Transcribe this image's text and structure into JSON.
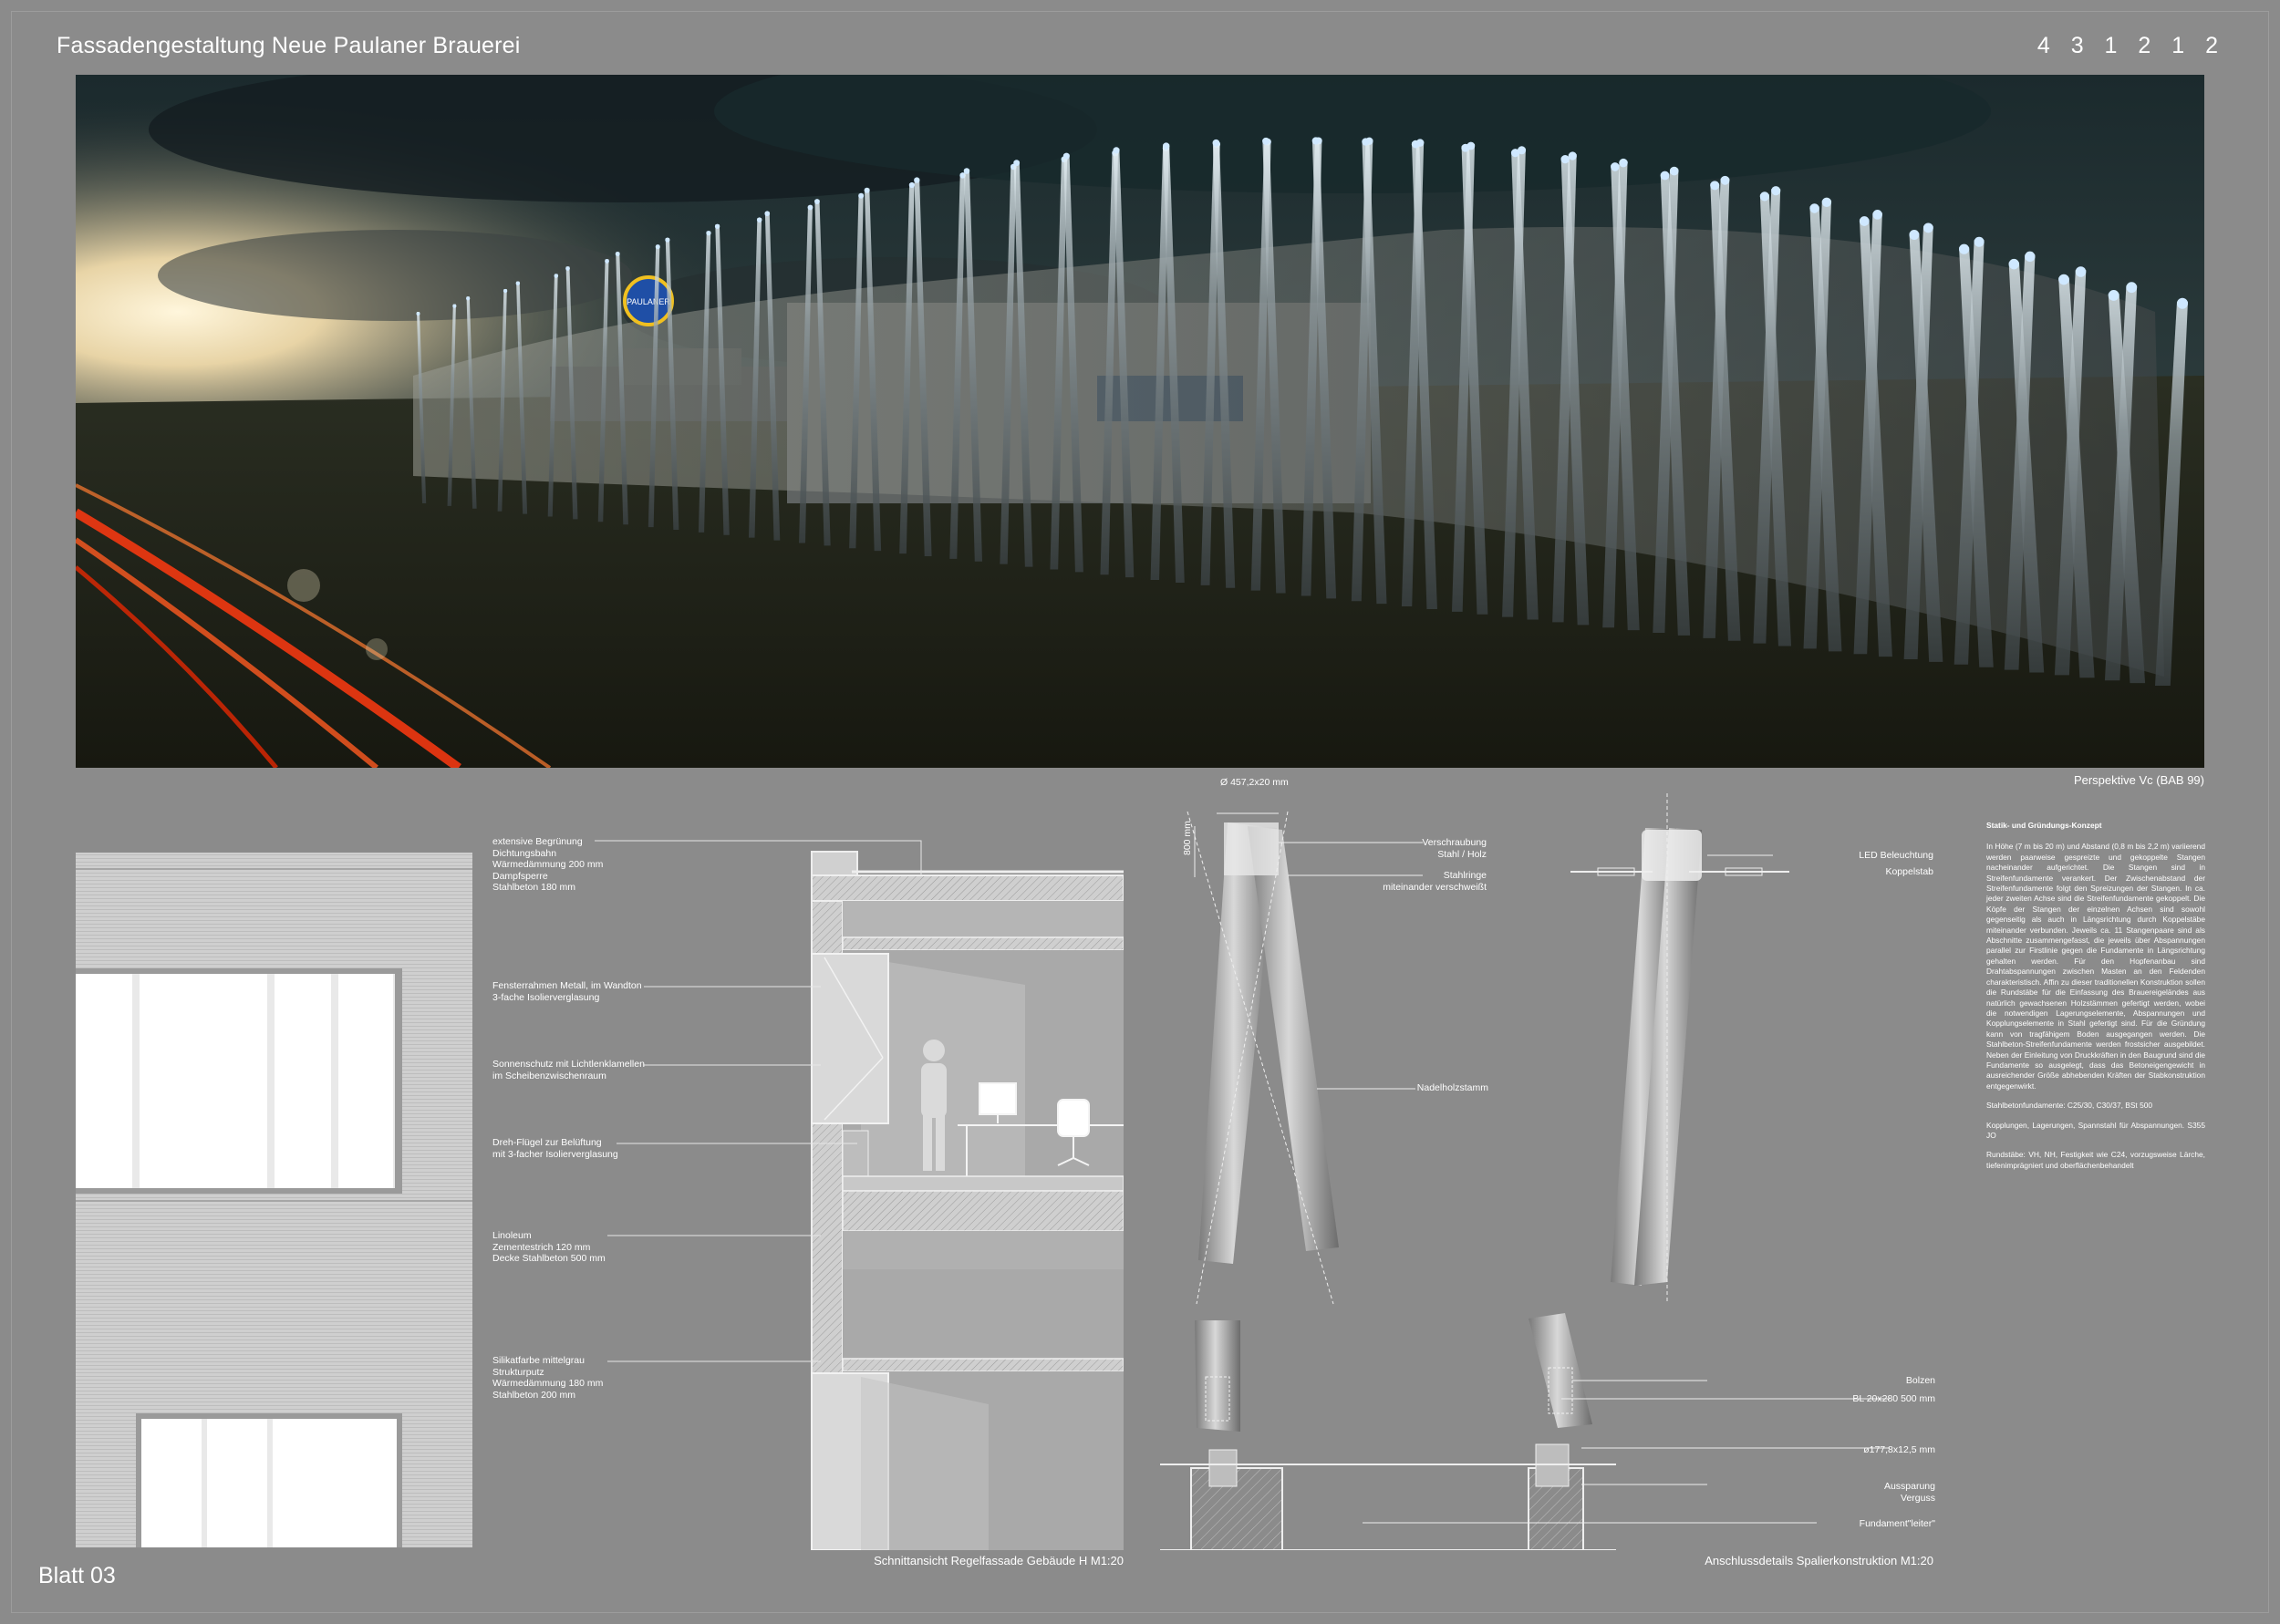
{
  "header": {
    "title": "Fassadengestaltung Neue Paulaner Brauerei",
    "code": "4 3 1 2 1 2"
  },
  "footer": {
    "sheet_label": "Blatt 03"
  },
  "hero": {
    "caption": "Perspektive Vc (BAB 99)",
    "logo_text": "PAULANER",
    "colors": {
      "sky_dark": "#1c2a2c",
      "sunset": "#e8d7b0",
      "lights": "#cfe8ff",
      "traffic": "#ff3a10"
    }
  },
  "section": {
    "caption": "Schnittansicht Regelfassade Gebäude H M1:20",
    "labels": [
      {
        "lines": [
          "extensive Begrünung",
          "Dichtungsbahn",
          "Wärmedämmung 200 mm",
          "Dampfsperre",
          "Stahlbeton 180 mm"
        ]
      },
      {
        "lines": [
          "Fensterrahmen Metall, im Wandton",
          "3-fache Isolierverglasung"
        ]
      },
      {
        "lines": [
          "Sonnenschutz mit Lichtlenklamellen",
          "im Scheibenzwischenraum"
        ]
      },
      {
        "lines": [
          "Dreh-Flügel zur Belüftung",
          "mit 3-facher Isolierverglasung"
        ]
      },
      {
        "lines": [
          "Linoleum",
          "Zementestrich 120 mm",
          "Decke Stahlbeton 500 mm"
        ]
      },
      {
        "lines": [
          "Silikatfarbe mittelgrau",
          "Strukturputz",
          "Wärmedämmung 180 mm",
          "Stahlbeton 200 mm"
        ]
      }
    ]
  },
  "details": {
    "caption": "Anschlussdetails Spalierkonstruktion M1:20",
    "dim_diameter": "Ø 457,2x20 mm",
    "dim_height": "800 mm",
    "labels": {
      "verschraubung": [
        "Verschraubung",
        "Stahl / Holz"
      ],
      "stahlringe": [
        "Stahlringe",
        "miteinander verschweißt"
      ],
      "nadelholz": [
        "Nadelholzstamm"
      ],
      "led": [
        "LED Beleuchtung"
      ],
      "koppelstab": [
        "Koppelstab"
      ],
      "bolzen": [
        "Bolzen"
      ],
      "bl": [
        "BL 20x280 500 mm"
      ],
      "rohr": [
        "ø177,8x12,5 mm"
      ],
      "aussparung": [
        "Aussparung",
        "Verguss"
      ],
      "fundament": [
        "Fundament\"leiter\""
      ]
    }
  },
  "concept": {
    "heading": "Statik- und Gründungs-Konzept",
    "paragraphs": [
      "In Höhe (7 m bis 20 m) und Abstand (0,8 m bis 2,2 m) variierend werden paarweise gespreizte und gekoppelte Stangen nacheinander aufgerichtet. Die Stangen sind in Streifenfundamente verankert. Der Zwischenabstand der Streifenfundamente folgt den Spreizungen der Stangen. In ca. jeder zweiten Achse sind die Streifenfundamente gekoppelt. Die Köpfe der Stangen der einzelnen Achsen sind sowohl gegenseitig als auch in Längsrichtung durch Koppelstäbe miteinander verbunden. Jeweils ca. 11 Stangenpaare sind als Abschnitte zusammengefasst, die jeweils über Abspannungen parallel zur Firstlinie gegen die Fundamente in Längsrichtung gehalten werden. Für den Hopfenanbau sind Drahtabspannungen zwischen Masten an den Feldenden charakteristisch. Affin zu dieser traditionellen Konstruktion sollen die Rundstäbe für die Einfassung des Brauereigeländes aus natürlich gewachsenen Holzstämmen gefertigt werden, wobei die notwendigen Lagerungselemente, Abspannungen und Kopplungselemente in Stahl gefertigt sind. Für die Gründung kann von tragfähigem Boden ausgegangen werden. Die Stahlbeton-Streifenfundamente werden frostsicher ausgebildet. Neben der Einleitung von Druckkräften in den Baugrund sind die Fundamente so ausgelegt, dass das Betoneigengewicht in ausreichender Größe abhebenden Kräften der Stabkonstruktion entgegenwirkt.",
      "Stahlbetonfundamente: C25/30, C30/37, BSt 500",
      "Kopplungen, Lagerungen, Spannstahl für Abspannungen. S355 JO",
      "Rundstäbe: VH, NH, Festigkeit wie C24, vorzugsweise Lärche, tiefenimprägniert und oberflächenbehandelt"
    ]
  }
}
